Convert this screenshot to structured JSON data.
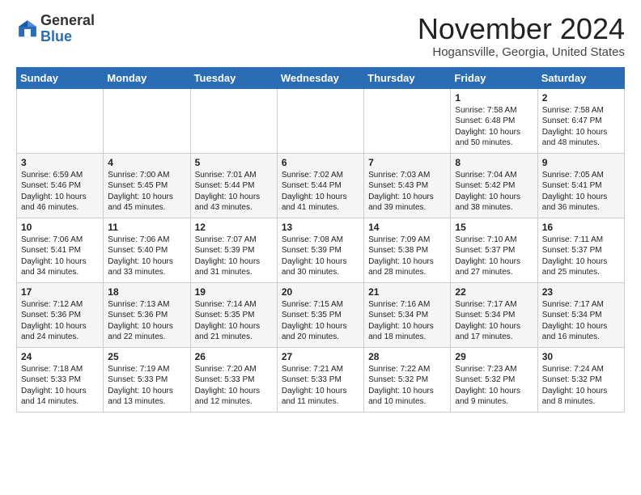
{
  "header": {
    "logo_line1": "General",
    "logo_line2": "Blue",
    "month": "November 2024",
    "location": "Hogansville, Georgia, United States"
  },
  "weekdays": [
    "Sunday",
    "Monday",
    "Tuesday",
    "Wednesday",
    "Thursday",
    "Friday",
    "Saturday"
  ],
  "weeks": [
    [
      {
        "day": "",
        "info": ""
      },
      {
        "day": "",
        "info": ""
      },
      {
        "day": "",
        "info": ""
      },
      {
        "day": "",
        "info": ""
      },
      {
        "day": "",
        "info": ""
      },
      {
        "day": "1",
        "info": "Sunrise: 7:58 AM\nSunset: 6:48 PM\nDaylight: 10 hours\nand 50 minutes."
      },
      {
        "day": "2",
        "info": "Sunrise: 7:58 AM\nSunset: 6:47 PM\nDaylight: 10 hours\nand 48 minutes."
      }
    ],
    [
      {
        "day": "3",
        "info": "Sunrise: 6:59 AM\nSunset: 5:46 PM\nDaylight: 10 hours\nand 46 minutes."
      },
      {
        "day": "4",
        "info": "Sunrise: 7:00 AM\nSunset: 5:45 PM\nDaylight: 10 hours\nand 45 minutes."
      },
      {
        "day": "5",
        "info": "Sunrise: 7:01 AM\nSunset: 5:44 PM\nDaylight: 10 hours\nand 43 minutes."
      },
      {
        "day": "6",
        "info": "Sunrise: 7:02 AM\nSunset: 5:44 PM\nDaylight: 10 hours\nand 41 minutes."
      },
      {
        "day": "7",
        "info": "Sunrise: 7:03 AM\nSunset: 5:43 PM\nDaylight: 10 hours\nand 39 minutes."
      },
      {
        "day": "8",
        "info": "Sunrise: 7:04 AM\nSunset: 5:42 PM\nDaylight: 10 hours\nand 38 minutes."
      },
      {
        "day": "9",
        "info": "Sunrise: 7:05 AM\nSunset: 5:41 PM\nDaylight: 10 hours\nand 36 minutes."
      }
    ],
    [
      {
        "day": "10",
        "info": "Sunrise: 7:06 AM\nSunset: 5:41 PM\nDaylight: 10 hours\nand 34 minutes."
      },
      {
        "day": "11",
        "info": "Sunrise: 7:06 AM\nSunset: 5:40 PM\nDaylight: 10 hours\nand 33 minutes."
      },
      {
        "day": "12",
        "info": "Sunrise: 7:07 AM\nSunset: 5:39 PM\nDaylight: 10 hours\nand 31 minutes."
      },
      {
        "day": "13",
        "info": "Sunrise: 7:08 AM\nSunset: 5:39 PM\nDaylight: 10 hours\nand 30 minutes."
      },
      {
        "day": "14",
        "info": "Sunrise: 7:09 AM\nSunset: 5:38 PM\nDaylight: 10 hours\nand 28 minutes."
      },
      {
        "day": "15",
        "info": "Sunrise: 7:10 AM\nSunset: 5:37 PM\nDaylight: 10 hours\nand 27 minutes."
      },
      {
        "day": "16",
        "info": "Sunrise: 7:11 AM\nSunset: 5:37 PM\nDaylight: 10 hours\nand 25 minutes."
      }
    ],
    [
      {
        "day": "17",
        "info": "Sunrise: 7:12 AM\nSunset: 5:36 PM\nDaylight: 10 hours\nand 24 minutes."
      },
      {
        "day": "18",
        "info": "Sunrise: 7:13 AM\nSunset: 5:36 PM\nDaylight: 10 hours\nand 22 minutes."
      },
      {
        "day": "19",
        "info": "Sunrise: 7:14 AM\nSunset: 5:35 PM\nDaylight: 10 hours\nand 21 minutes."
      },
      {
        "day": "20",
        "info": "Sunrise: 7:15 AM\nSunset: 5:35 PM\nDaylight: 10 hours\nand 20 minutes."
      },
      {
        "day": "21",
        "info": "Sunrise: 7:16 AM\nSunset: 5:34 PM\nDaylight: 10 hours\nand 18 minutes."
      },
      {
        "day": "22",
        "info": "Sunrise: 7:17 AM\nSunset: 5:34 PM\nDaylight: 10 hours\nand 17 minutes."
      },
      {
        "day": "23",
        "info": "Sunrise: 7:17 AM\nSunset: 5:34 PM\nDaylight: 10 hours\nand 16 minutes."
      }
    ],
    [
      {
        "day": "24",
        "info": "Sunrise: 7:18 AM\nSunset: 5:33 PM\nDaylight: 10 hours\nand 14 minutes."
      },
      {
        "day": "25",
        "info": "Sunrise: 7:19 AM\nSunset: 5:33 PM\nDaylight: 10 hours\nand 13 minutes."
      },
      {
        "day": "26",
        "info": "Sunrise: 7:20 AM\nSunset: 5:33 PM\nDaylight: 10 hours\nand 12 minutes."
      },
      {
        "day": "27",
        "info": "Sunrise: 7:21 AM\nSunset: 5:33 PM\nDaylight: 10 hours\nand 11 minutes."
      },
      {
        "day": "28",
        "info": "Sunrise: 7:22 AM\nSunset: 5:32 PM\nDaylight: 10 hours\nand 10 minutes."
      },
      {
        "day": "29",
        "info": "Sunrise: 7:23 AM\nSunset: 5:32 PM\nDaylight: 10 hours\nand 9 minutes."
      },
      {
        "day": "30",
        "info": "Sunrise: 7:24 AM\nSunset: 5:32 PM\nDaylight: 10 hours\nand 8 minutes."
      }
    ]
  ]
}
